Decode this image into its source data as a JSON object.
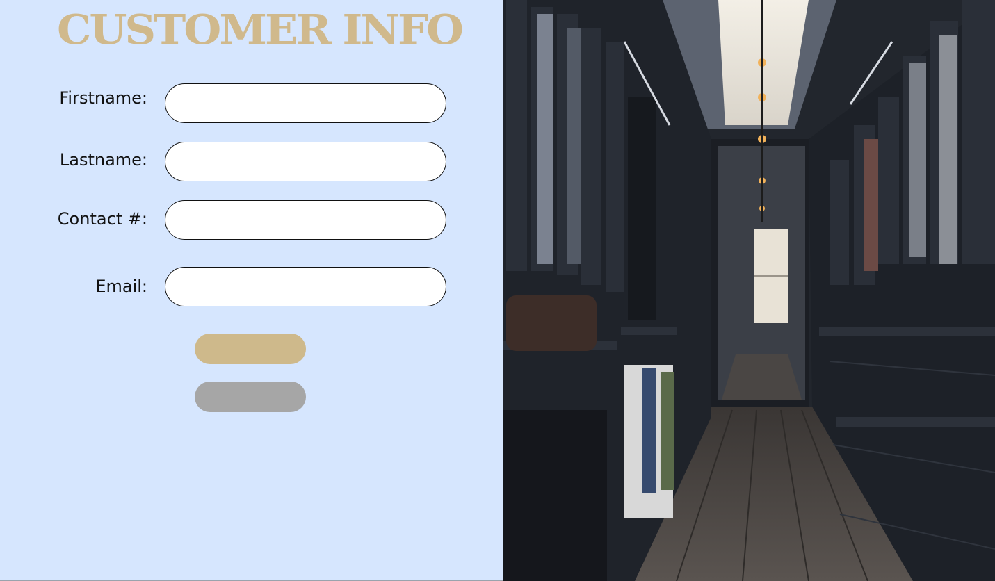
{
  "page": {
    "title": "CUSTOMER INFO"
  },
  "form": {
    "fields": [
      {
        "label": "Firstname:",
        "value": "",
        "placeholder": ""
      },
      {
        "label": "Lastname:",
        "value": "",
        "placeholder": ""
      },
      {
        "label": "Contact #:",
        "value": "",
        "placeholder": ""
      },
      {
        "label": "Email:",
        "value": "",
        "placeholder": ""
      }
    ],
    "buttons": {
      "submit_label": "",
      "clear_label": ""
    }
  },
  "colors": {
    "background": "#d6e6fe",
    "title": "#d0b98c",
    "submit_button": "#ceb98b",
    "clear_button": "#a6a6a6"
  },
  "image": {
    "subject": "walk-in-closet-photo"
  }
}
